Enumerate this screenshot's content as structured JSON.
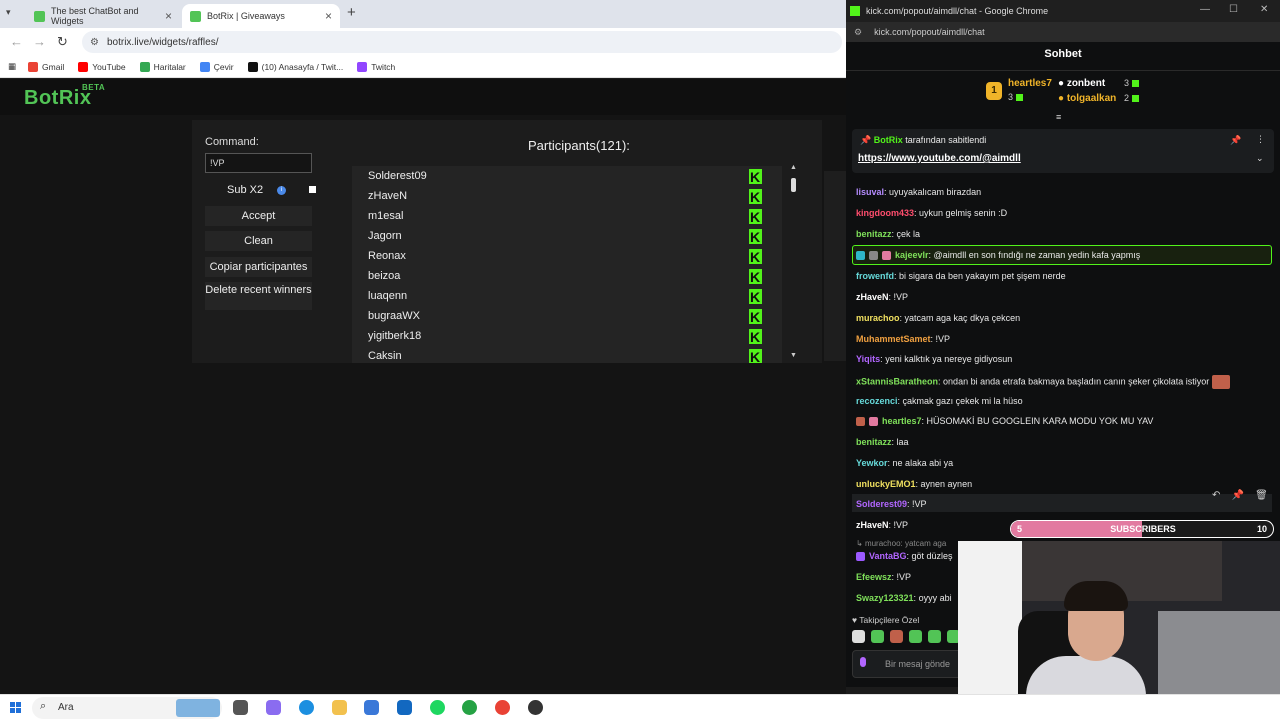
{
  "browser": {
    "tabs": [
      {
        "title": "The best ChatBot and Widgets"
      },
      {
        "title": "BotRix | Giveaways"
      }
    ],
    "url": "botrix.live/widgets/raffles/",
    "bookmarks": [
      "Gmail",
      "YouTube",
      "Haritalar",
      "Çevir",
      "(10) Anasayfa / Twit...",
      "Twitch"
    ]
  },
  "botrix": {
    "logo": "BotRix",
    "badge": "BETA",
    "command_label": "Command:",
    "command_value": "!VP",
    "sub_label": "Sub X2",
    "buttons": {
      "accept": "Accept",
      "clean": "Clean",
      "copy": "Copiar participantes",
      "delete": "Delete recent winners"
    },
    "participants_title": "Participants(121):",
    "participants": [
      "Solderest09",
      "zHaveN",
      "m1esal",
      "Jagorn",
      "Reonax",
      "beizoa",
      "luaqenn",
      "bugraaWX",
      "yigitberk18",
      "Caksin"
    ]
  },
  "kick_window": {
    "title": "kick.com/popout/aimdll/chat - Google Chrome",
    "url": "kick.com/popout/aimdll/chat"
  },
  "chat": {
    "header": "Sohbet",
    "leaderboard": [
      {
        "name": "heartles7",
        "count": "3",
        "color": "#f0b429"
      },
      {
        "name": "zonbent",
        "count": "3",
        "color": "#ffffff"
      },
      {
        "name": "tolgaalkan",
        "count": "2",
        "color": "#f0b429"
      }
    ],
    "pinned": {
      "by_user": "BotRix",
      "by_text": "tarafından sabitlendi",
      "link": "https://www.youtube.com/@aimdll"
    },
    "messages": [
      {
        "user": "lisuval",
        "text": "uyuyakalıcam birazdan",
        "color": "#b58cff"
      },
      {
        "user": "kingdoom433",
        "text": "uykun gelmiş senin :D",
        "color": "#ff4d6d"
      },
      {
        "user": "benitazz",
        "text": "çek la",
        "color": "#7fe05a"
      },
      {
        "user": "kajeevlr",
        "text": "@aimdll en son fındığı ne zaman yedin kafa yapmış",
        "color": "#7fe05a"
      },
      {
        "user": "frowenfd",
        "text": "bi sigara da ben yakayım pet şişem nerde",
        "color": "#66d9d9"
      },
      {
        "user": "zHaveN",
        "text": "!VP",
        "color": "#ffffff"
      },
      {
        "user": "murachoo",
        "text": "yatcam aga kaç dkya çekcen",
        "color": "#f0e060"
      },
      {
        "user": "MuhammetSamet",
        "text": "!VP",
        "color": "#f0a040"
      },
      {
        "user": "Yiqits",
        "text": "yeni kalktık ya nereye gidiyosun",
        "color": "#b266ff"
      },
      {
        "user": "xStannisBaratheon",
        "text": "ondan bi anda etrafa bakmaya başladın canın şeker çikolata istiyor",
        "color": "#7fe05a"
      },
      {
        "user": "recozenci",
        "text": "çakmak gazı çekek mi la hüso",
        "color": "#66d9d9"
      },
      {
        "user": "heartles7",
        "text": "HÜSOMAKİ BU GOOGLEIN KARA MODU YOK MU YAV",
        "color": "#7fe05a"
      },
      {
        "user": "benitazz",
        "text": "laa",
        "color": "#7fe05a"
      },
      {
        "user": "Yewkor",
        "text": "ne alaka abi ya",
        "color": "#66d9d9"
      },
      {
        "user": "unluckyEMO1",
        "text": "aynen aynen",
        "color": "#f0e060"
      },
      {
        "user": "Solderest09",
        "text": "!VP",
        "color": "#b266ff"
      },
      {
        "user": "zHaveN",
        "text": "!VP",
        "color": "#ffffff"
      },
      {
        "user": "VantaBG",
        "text": "göt düzleş",
        "color": "#b266ff"
      },
      {
        "user": "Efeewsz",
        "text": "!VP",
        "color": "#7fe05a"
      },
      {
        "user": "Swazy123321",
        "text": "oyyy abi",
        "color": "#7fe05a"
      }
    ],
    "reply_preview": "murachoo: yatcam aga",
    "follower_only": "Takipçilere Özel",
    "input_placeholder": "Bir mesaj gönde"
  },
  "sub_goal": {
    "current": "5",
    "label": "SUBSCRIBERS",
    "goal": "10",
    "progress": 0.5
  },
  "taskbar": {
    "search_placeholder": "Ara"
  },
  "colors": {
    "botrix_green": "#52c456",
    "kick_green": "#52f31a",
    "page_bg": "#141414"
  }
}
